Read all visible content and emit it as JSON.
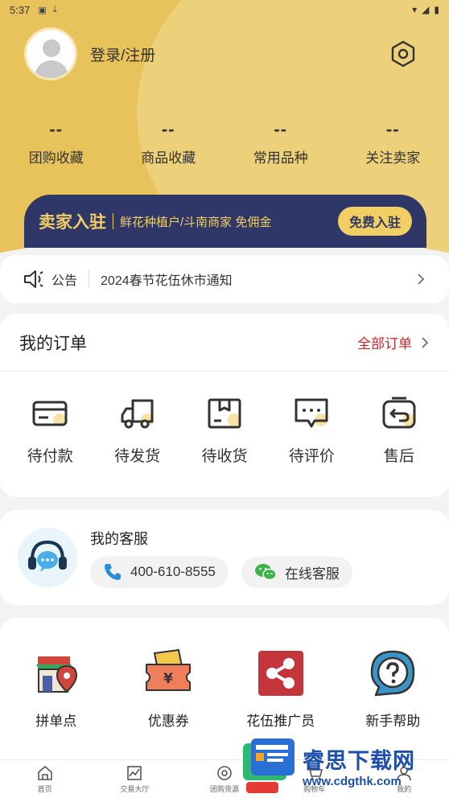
{
  "status_bar": {
    "time": "5:37",
    "icons": [
      "notification-a-icon",
      "download-icon"
    ],
    "right_icons": [
      "wifi-icon",
      "signal-icon",
      "battery-icon"
    ]
  },
  "profile": {
    "login_text": "登录/注册",
    "avatar_icon": "user-avatar-icon",
    "settings_icon": "settings-hexagon-icon"
  },
  "stats": [
    {
      "value": "--",
      "label": "团购收藏"
    },
    {
      "value": "--",
      "label": "商品收藏"
    },
    {
      "value": "--",
      "label": "常用品种"
    },
    {
      "value": "--",
      "label": "关注卖家"
    }
  ],
  "seller_banner": {
    "title": "卖家入驻",
    "desc": "鲜花种植户/斗南商家 免佣金",
    "button": "免费入驻"
  },
  "notice": {
    "label": "公告",
    "text": "2024春节花伍休市通知"
  },
  "orders": {
    "title": "我的订单",
    "all_label": "全部订单",
    "items": [
      {
        "label": "待付款",
        "icon": "wallet-card-icon"
      },
      {
        "label": "待发货",
        "icon": "truck-icon"
      },
      {
        "label": "待收货",
        "icon": "package-icon"
      },
      {
        "label": "待评价",
        "icon": "comment-icon"
      },
      {
        "label": "售后",
        "icon": "return-icon"
      }
    ]
  },
  "service": {
    "title": "我的客服",
    "phone": "400-610-8555",
    "online": "在线客服"
  },
  "tools": [
    {
      "label": "拼单点",
      "icon": "store-location-icon"
    },
    {
      "label": "优惠券",
      "icon": "coupon-icon"
    },
    {
      "label": "花伍推广员",
      "icon": "share-icon"
    },
    {
      "label": "新手帮助",
      "icon": "help-icon"
    }
  ],
  "tabbar": [
    {
      "label": "首页",
      "icon": "home-icon"
    },
    {
      "label": "交易大厅",
      "icon": "trade-chart-icon"
    },
    {
      "label": "团购货源",
      "icon": "group-buy-icon"
    },
    {
      "label": "购物车",
      "icon": "cart-icon"
    },
    {
      "label": "我的",
      "icon": "user-icon"
    }
  ],
  "watermark": {
    "title": "睿思下载网",
    "url": "www.cdgthk.com"
  },
  "colors": {
    "header": "#e8c25a",
    "banner": "#2f3768",
    "banner_text": "#f2cf63",
    "accent_red": "#c0292b"
  }
}
